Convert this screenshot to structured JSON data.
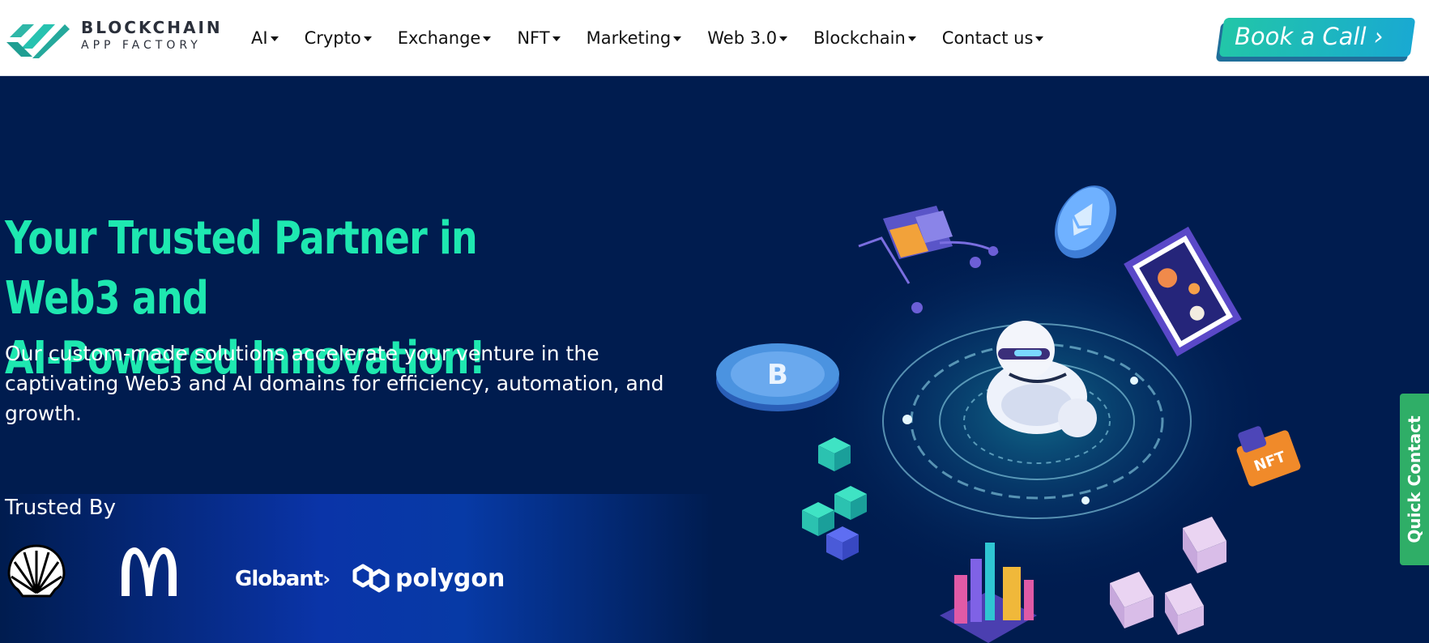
{
  "brand": {
    "line1": "BLOCKCHAIN",
    "line2": "APP FACTORY"
  },
  "nav": {
    "items": [
      {
        "label": "AI"
      },
      {
        "label": "Crypto"
      },
      {
        "label": "Exchange"
      },
      {
        "label": "NFT"
      },
      {
        "label": "Marketing"
      },
      {
        "label": "Web 3.0"
      },
      {
        "label": "Blockchain"
      },
      {
        "label": "Contact us"
      }
    ]
  },
  "cta": {
    "label": "Book a Call"
  },
  "hero": {
    "title_line1": "Your Trusted Partner in Web3 and",
    "title_line2": "AI-Powered Innovation!",
    "description": "Our custom-made solutions accelerate your venture in the captivating Web3 and AI domains for efficiency, automation, and growth."
  },
  "trusted": {
    "label": "Trusted By",
    "logos": [
      {
        "icon": "shell-logo"
      },
      {
        "icon": "mcdonalds-logo"
      },
      {
        "text": "Globant"
      },
      {
        "text": "polygon"
      }
    ]
  },
  "quick_contact": {
    "label": "Quick Contact"
  },
  "illustration": {
    "coin1": "B",
    "nft_badge": "NFT"
  },
  "colors": {
    "accent": "#1ee8b0",
    "background": "#001c4f",
    "cta_start": "#22c6a8",
    "cta_end": "#19a9d2",
    "quick_contact": "#2fae67"
  }
}
